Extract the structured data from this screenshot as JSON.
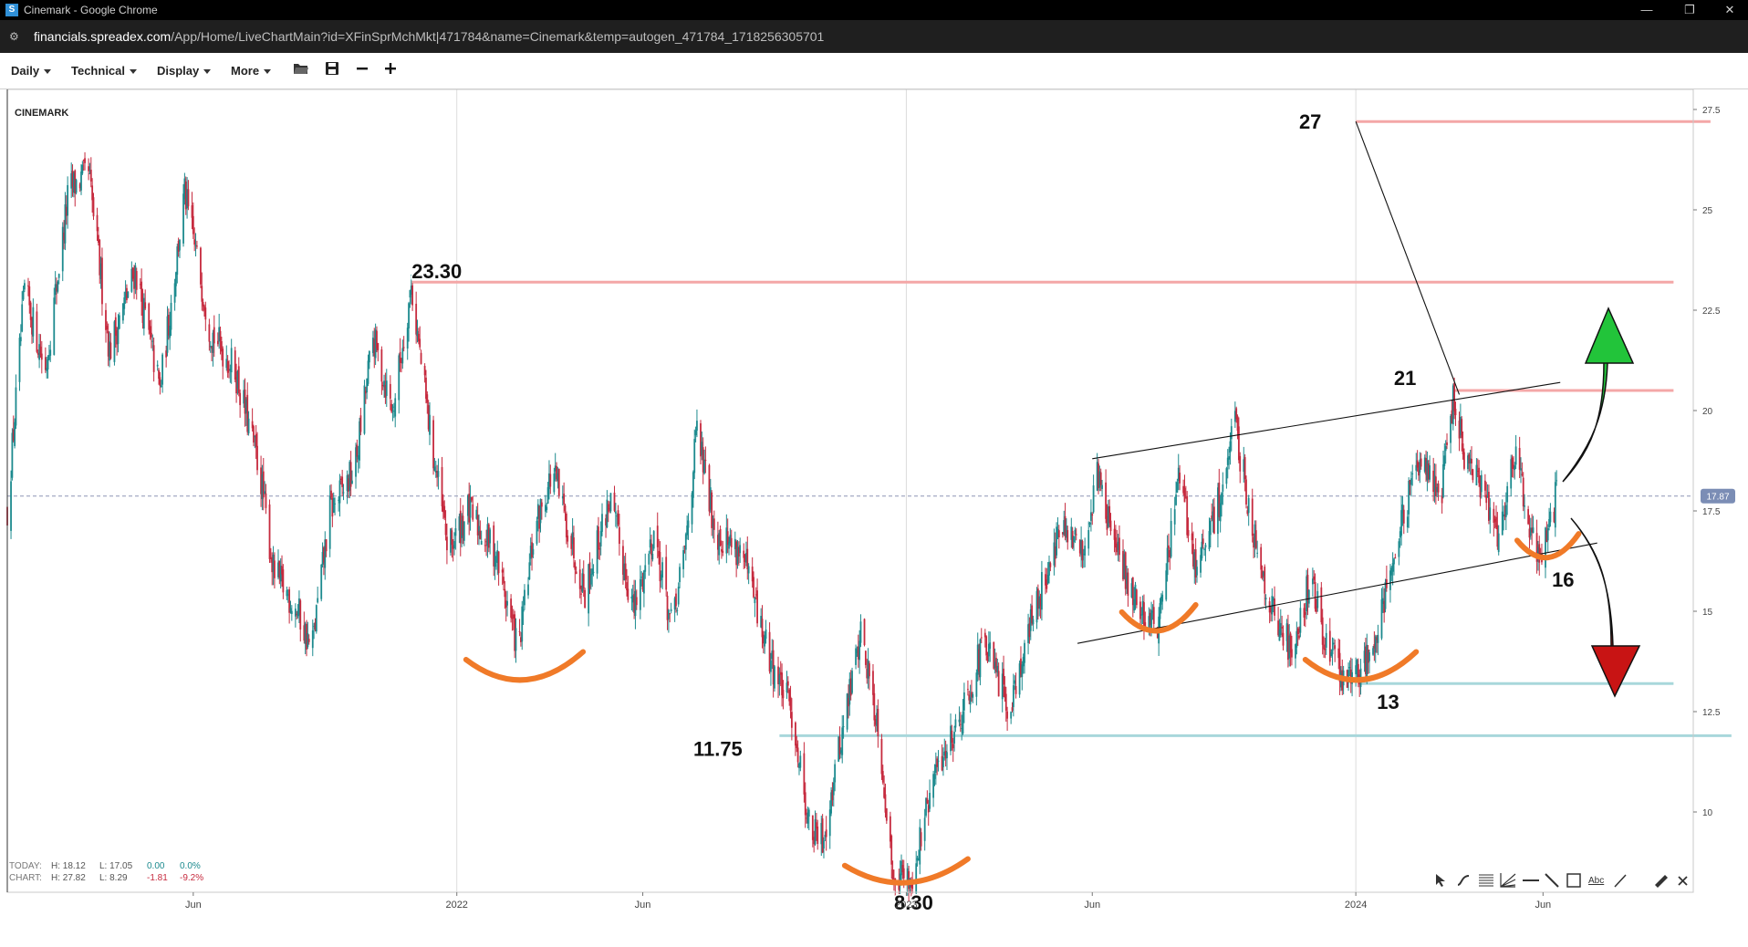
{
  "window": {
    "title": "Cinemark - Google Chrome",
    "app_icon_letter": "S",
    "minimize_glyph": "—",
    "restore_glyph": "❐",
    "close_glyph": "✕"
  },
  "address": {
    "host": "financials.spreadex.com",
    "path": "/App/Home/LiveChartMain?id=XFinSprMchMkt|471784&name=Cinemark&temp=autogen_471784_1718256305701"
  },
  "toolbar": {
    "daily_label": "Daily",
    "technical_label": "Technical",
    "display_label": "Display",
    "more_label": "More",
    "open_icon": "folder-open-icon",
    "save_icon": "save-icon",
    "zoom_out_icon": "minus-icon",
    "zoom_in_icon": "plus-icon"
  },
  "info": {
    "today_label": "TODAY:",
    "today_high": "H: 18.12",
    "today_low": "L: 17.05",
    "today_change": "0.00",
    "today_pct": "0.0%",
    "chart_label": "CHART:",
    "chart_high": "H: 27.82",
    "chart_low": "L: 8.29",
    "chart_change": "-1.81",
    "chart_pct": "-9.2%"
  },
  "colors": {
    "bull": "#1c8a8e",
    "bear": "#c62a3e",
    "resistance": "#f4a7a7",
    "support": "#a8d7db",
    "arc": "#f07a28",
    "up_arrow": "#22c43a",
    "down_arrow": "#c81414",
    "current_price_badge": "#7b8db5"
  },
  "drawing_tools": [
    "cursor-arrow-icon",
    "curve-icon",
    "fib-grid-icon",
    "fan-icon",
    "horizontal-line-icon",
    "trend-line-icon",
    "rectangle-icon",
    "text-abc-icon",
    "pencil-line-icon",
    "ruler-icon",
    "close-icon"
  ],
  "drawing_tools_text_label": "Abc",
  "chart_data": {
    "type": "candlestick",
    "title": "CINEMARK",
    "y_ticks": [
      "10",
      "12.5",
      "15",
      "17.5",
      "20",
      "22.5",
      "25",
      "27.5"
    ],
    "ylim": [
      8.0,
      28.0
    ],
    "x_tick_labels": [
      "Jun",
      "2022",
      "Jun",
      "2023",
      "Jun",
      "2024",
      "Jun"
    ],
    "x_tick_dates": [
      "2021-06-01",
      "2022-01-01",
      "2022-06-01",
      "2023-01-01",
      "2023-06-01",
      "2024-01-01",
      "2024-06-01"
    ],
    "x_range": [
      "2021-01-01",
      "2024-10-01"
    ],
    "grid": "vertical-at-years",
    "current_price": 17.87,
    "current_price_label": "17.87",
    "price_path": [
      [
        "2021-01-01",
        17.5
      ],
      [
        "2021-01-15",
        23.0
      ],
      [
        "2021-02-01",
        21.0
      ],
      [
        "2021-02-20",
        25.5
      ],
      [
        "2021-03-08",
        25.9
      ],
      [
        "2021-03-25",
        21.5
      ],
      [
        "2021-04-15",
        23.5
      ],
      [
        "2021-05-05",
        20.5
      ],
      [
        "2021-05-25",
        25.4
      ],
      [
        "2021-06-15",
        22.0
      ],
      [
        "2021-07-05",
        21.0
      ],
      [
        "2021-07-25",
        18.5
      ],
      [
        "2021-08-05",
        16.0
      ],
      [
        "2021-08-25",
        15.0
      ],
      [
        "2021-09-05",
        14.0
      ],
      [
        "2021-09-20",
        17.5
      ],
      [
        "2021-10-10",
        18.5
      ],
      [
        "2021-10-25",
        21.8
      ],
      [
        "2021-11-10",
        20.0
      ],
      [
        "2021-11-25",
        23.1
      ],
      [
        "2021-12-10",
        19.5
      ],
      [
        "2021-12-25",
        16.5
      ],
      [
        "2022-01-10",
        17.5
      ],
      [
        "2022-02-01",
        16.5
      ],
      [
        "2022-02-20",
        14.0
      ],
      [
        "2022-03-05",
        17.0
      ],
      [
        "2022-03-20",
        18.5
      ],
      [
        "2022-04-15",
        15.5
      ],
      [
        "2022-05-05",
        17.8
      ],
      [
        "2022-05-25",
        15.0
      ],
      [
        "2022-06-10",
        17.0
      ],
      [
        "2022-06-25",
        14.5
      ],
      [
        "2022-07-05",
        16.5
      ],
      [
        "2022-07-15",
        19.5
      ],
      [
        "2022-07-30",
        17.0
      ],
      [
        "2022-08-20",
        16.5
      ],
      [
        "2022-09-10",
        14.0
      ],
      [
        "2022-09-30",
        12.5
      ],
      [
        "2022-10-15",
        9.5
      ],
      [
        "2022-10-25",
        9.3
      ],
      [
        "2022-11-10",
        12.0
      ],
      [
        "2022-11-25",
        14.5
      ],
      [
        "2022-12-10",
        12.0
      ],
      [
        "2022-12-20",
        8.6
      ],
      [
        "2023-01-05",
        8.3
      ],
      [
        "2023-01-25",
        11.0
      ],
      [
        "2023-02-15",
        12.5
      ],
      [
        "2023-03-05",
        14.2
      ],
      [
        "2023-03-25",
        12.6
      ],
      [
        "2023-04-15",
        15.0
      ],
      [
        "2023-05-05",
        17.0
      ],
      [
        "2023-05-25",
        16.5
      ],
      [
        "2023-06-05",
        18.5
      ],
      [
        "2023-06-20",
        16.5
      ],
      [
        "2023-07-10",
        15.0
      ],
      [
        "2023-07-25",
        14.7
      ],
      [
        "2023-08-10",
        18.3
      ],
      [
        "2023-08-25",
        16.0
      ],
      [
        "2023-09-10",
        17.5
      ],
      [
        "2023-09-25",
        19.6
      ],
      [
        "2023-10-10",
        17.0
      ],
      [
        "2023-10-25",
        15.0
      ],
      [
        "2023-11-10",
        14.0
      ],
      [
        "2023-11-25",
        15.8
      ],
      [
        "2023-12-10",
        14.0
      ],
      [
        "2023-12-25",
        13.2
      ],
      [
        "2024-01-10",
        13.8
      ],
      [
        "2024-01-25",
        15.5
      ],
      [
        "2024-02-10",
        17.5
      ],
      [
        "2024-02-25",
        19.0
      ],
      [
        "2024-03-10",
        17.8
      ],
      [
        "2024-03-20",
        20.3
      ],
      [
        "2024-04-01",
        18.5
      ],
      [
        "2024-04-15",
        18.0
      ],
      [
        "2024-04-25",
        17.0
      ],
      [
        "2024-05-10",
        19.0
      ],
      [
        "2024-05-20",
        17.2
      ],
      [
        "2024-05-30",
        16.3
      ],
      [
        "2024-06-12",
        17.9
      ]
    ],
    "annotations": [
      {
        "label": "23.30",
        "kind": "resistance",
        "value": 23.2,
        "from": "2021-11-25",
        "to": "2024-09-15",
        "label_at": "2021-11-25"
      },
      {
        "label": "27",
        "kind": "resistance",
        "value": 27.2,
        "from": "2024-01-01",
        "to": "2024-10-15",
        "label_at": "2023-11-25"
      },
      {
        "label": "21",
        "kind": "resistance",
        "value": 20.5,
        "from": "2024-03-20",
        "to": "2024-09-15",
        "label_at": "2024-02-10"
      },
      {
        "label": "11.75",
        "kind": "support",
        "value": 11.9,
        "from": "2022-09-20",
        "to": "2024-11-01",
        "label_at": "2022-08-01"
      },
      {
        "label": "13",
        "kind": "support",
        "value": 13.2,
        "from": "2024-01-05",
        "to": "2024-09-15",
        "label_at": "2024-01-05"
      },
      {
        "label": "8.30",
        "kind": "label",
        "value": 8.3,
        "from": "2023-01-01",
        "to": "2023-01-01",
        "label_at": "2023-01-01"
      },
      {
        "label": "16",
        "kind": "label",
        "value": 16.3,
        "from": "2024-06-01",
        "to": "2024-06-01",
        "label_at": "2024-06-01"
      }
    ],
    "trend_lines": [
      {
        "from": [
          "2023-06-01",
          18.8
        ],
        "to": [
          "2024-06-15",
          20.7
        ]
      },
      {
        "from": [
          "2023-05-20",
          14.2
        ],
        "to": [
          "2024-07-15",
          16.7
        ]
      },
      {
        "from": [
          "2024-01-01",
          27.2
        ],
        "to": [
          "2024-03-25",
          20.4
        ]
      }
    ],
    "arcs": [
      {
        "center": "2022-02-25",
        "width_days": 95,
        "value": 13.6,
        "depth": 0.65
      },
      {
        "center": "2023-01-01",
        "width_days": 100,
        "value": 8.5,
        "depth": 0.55
      },
      {
        "center": "2023-07-25",
        "width_days": 60,
        "value": 14.8,
        "depth": 0.6
      },
      {
        "center": "2024-01-05",
        "width_days": 90,
        "value": 13.6,
        "depth": 0.65
      },
      {
        "center": "2024-06-05",
        "width_days": 50,
        "value": 16.6,
        "depth": 0.55
      }
    ]
  }
}
